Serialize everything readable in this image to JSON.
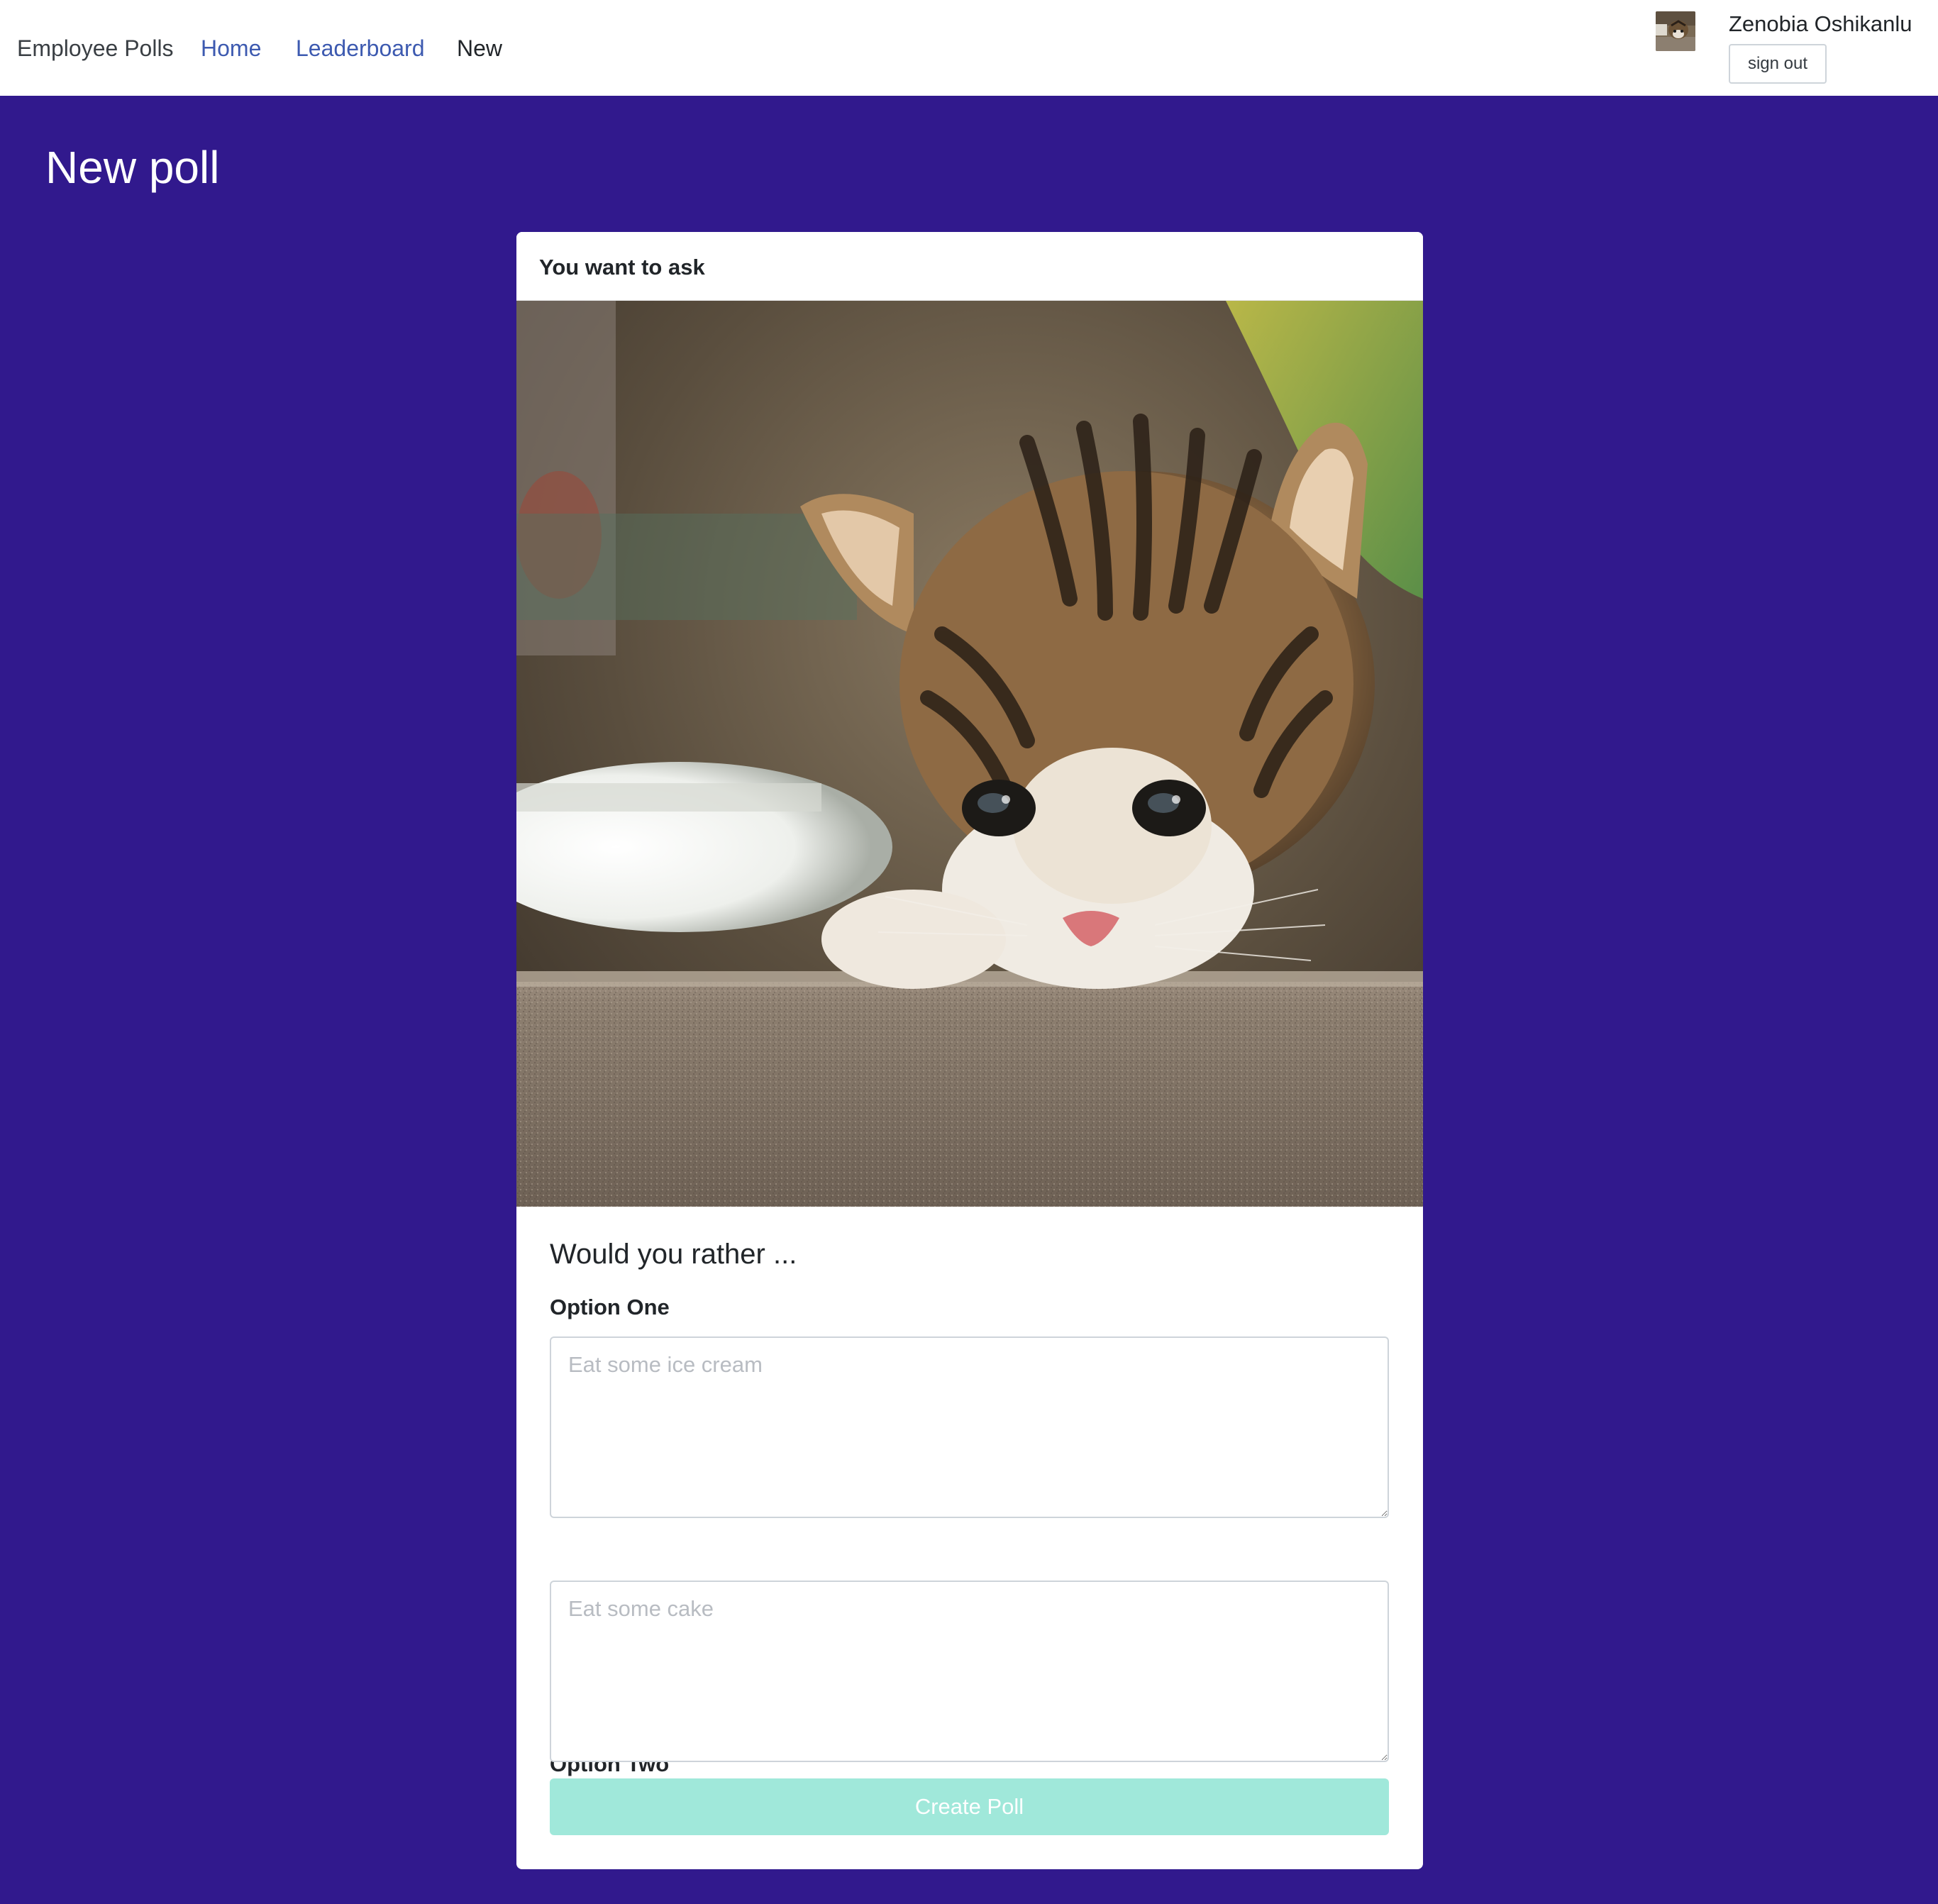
{
  "nav": {
    "brand": "Employee Polls",
    "home": "Home",
    "leaderboard": "Leaderboard",
    "new": "New"
  },
  "user": {
    "name": "Zenobia Oshikanlu",
    "signout_label": "sign out"
  },
  "page": {
    "title": "New poll"
  },
  "card": {
    "header": "You want to ask",
    "question": "Would you rather ...",
    "option_one": {
      "label": "Option One",
      "placeholder": "Eat some ice cream",
      "value": ""
    },
    "option_two": {
      "label": "Option Two",
      "placeholder": "Eat some cake",
      "value": ""
    },
    "submit_label": "Create Poll"
  },
  "colors": {
    "page_background": "#31198d",
    "link": "#3d5ab0",
    "submit_button": "#a0e8da"
  },
  "icons": {
    "avatar": "kitten-avatar-image",
    "card_image": "kitten-photo"
  }
}
